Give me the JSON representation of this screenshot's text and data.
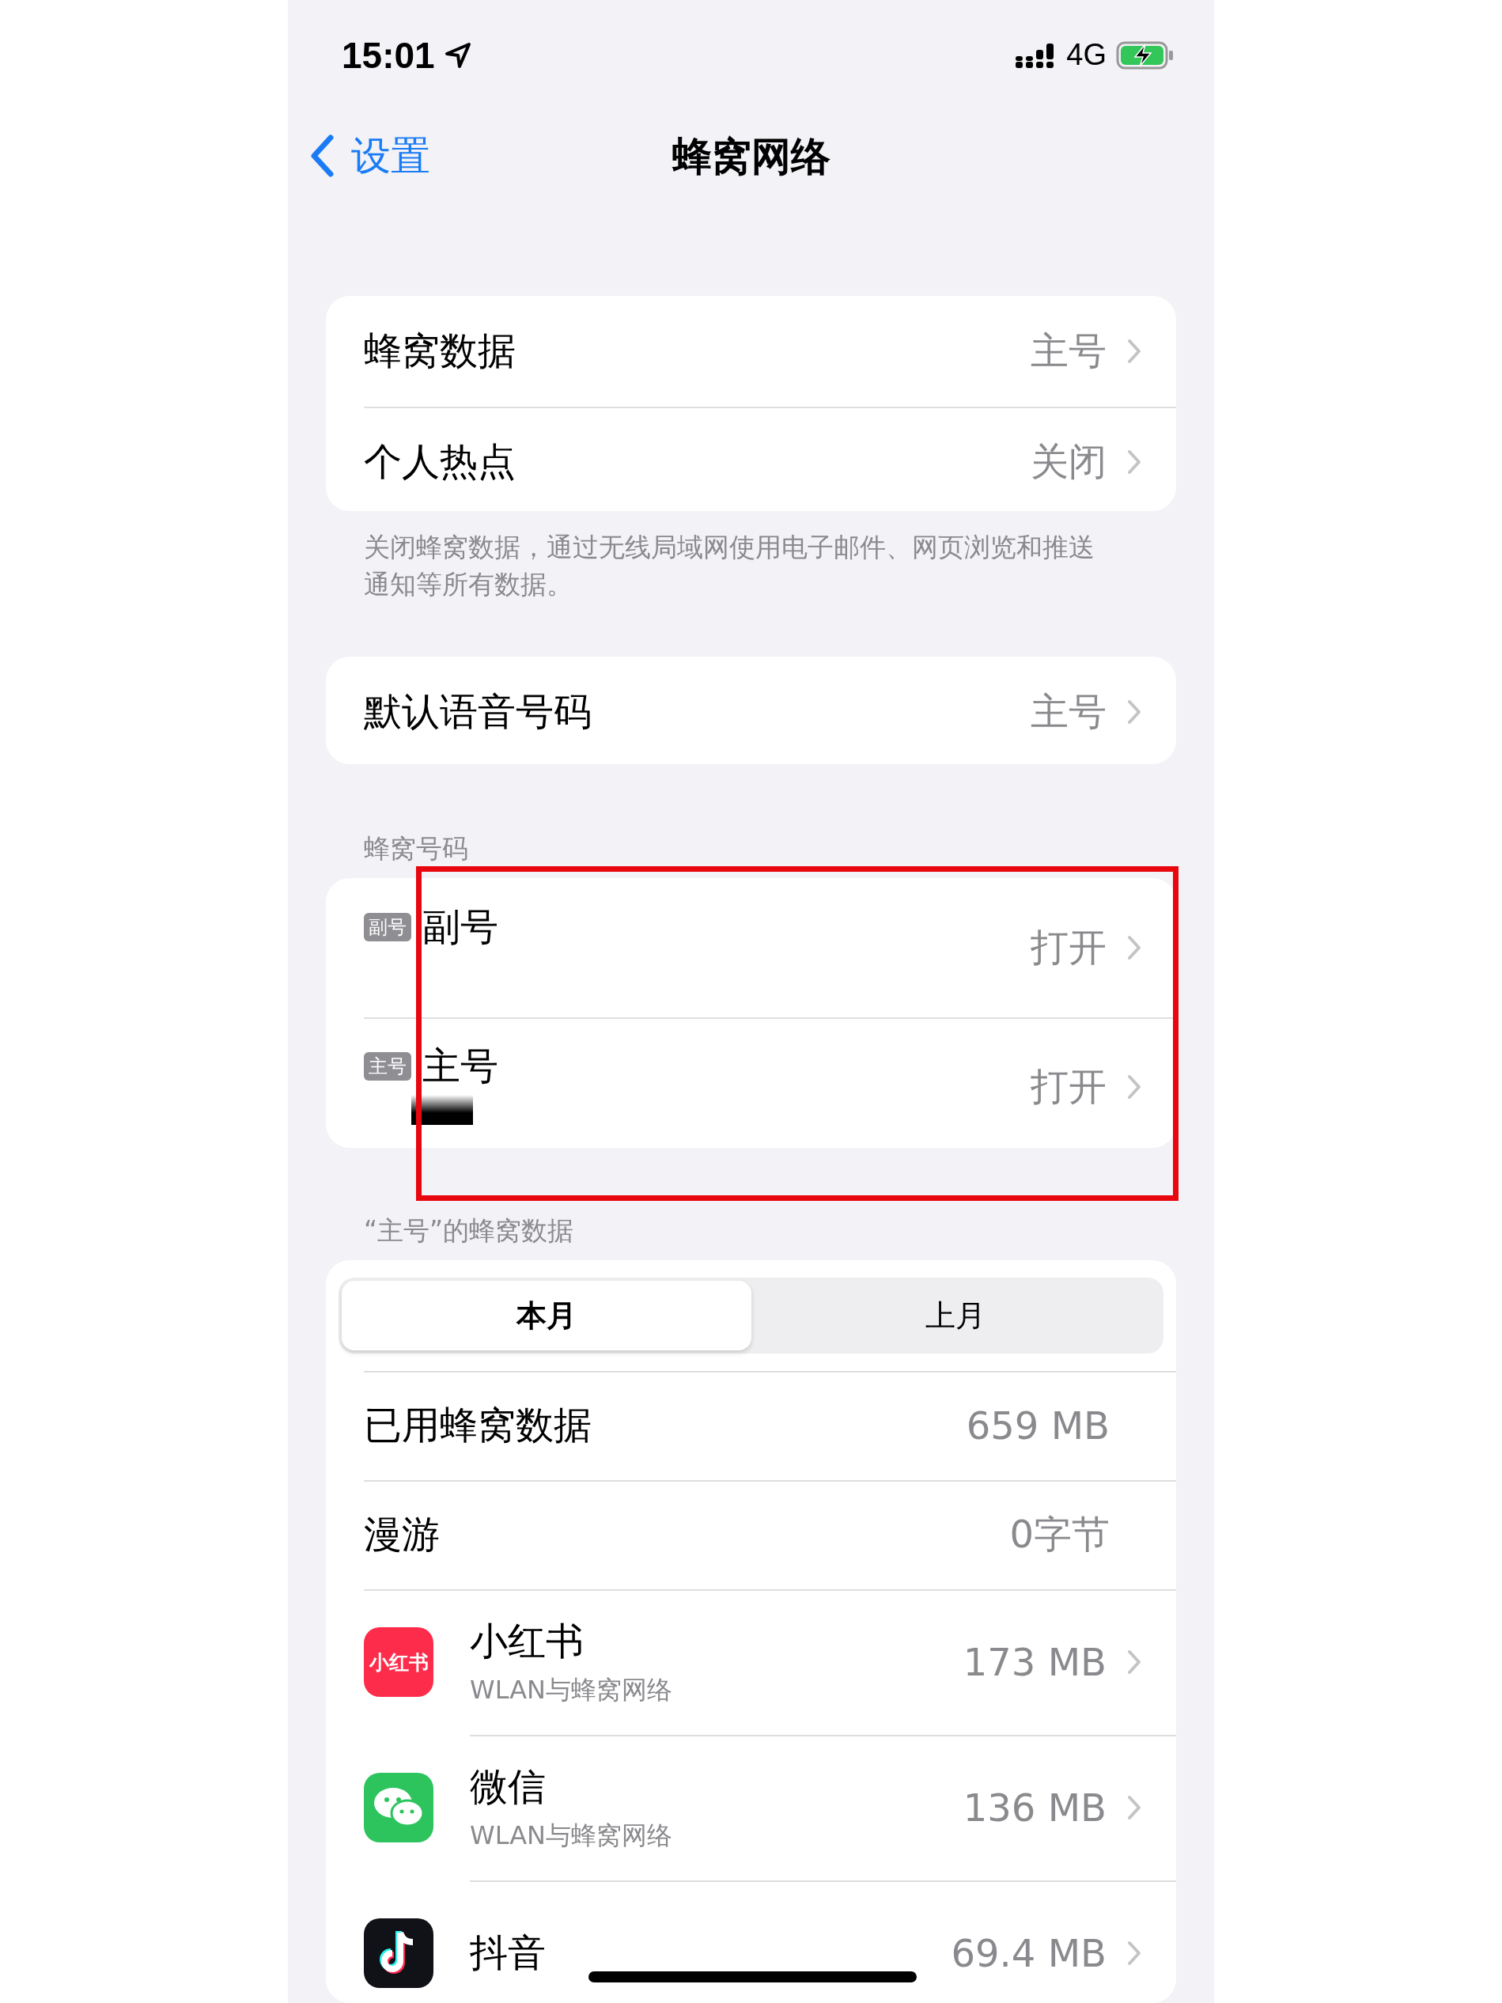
{
  "status_bar": {
    "time": "15:01",
    "network": "4G",
    "charging": true
  },
  "nav": {
    "back": "设置",
    "title": "蜂窝网络"
  },
  "group_1": {
    "rows": [
      {
        "label": "蜂窝数据",
        "value": "主号"
      },
      {
        "label": "个人热点",
        "value": "关闭"
      }
    ],
    "footer": "关闭蜂窝数据，通过无线局域网使用电子邮件、网页浏览和推送通知等所有数据。"
  },
  "group_2": {
    "rows": [
      {
        "label": "默认语音号码",
        "value": "主号"
      }
    ]
  },
  "numbers": {
    "header": "蜂窝号码",
    "rows": [
      {
        "badge": "副号",
        "label": "副号",
        "value": "打开",
        "redacted": false
      },
      {
        "badge": "主号",
        "label": "主号",
        "value": "打开",
        "redacted": true
      }
    ]
  },
  "annotation": {
    "kind": "highlight_frame"
  },
  "usage": {
    "header": "“主号”的蜂窝数据",
    "tabs": [
      {
        "label": "本月",
        "selected": true
      },
      {
        "label": "上月",
        "selected": false
      }
    ],
    "stats": [
      {
        "label": "已用蜂窝数据",
        "value": "659 MB"
      },
      {
        "label": "漫游",
        "value": "0字节"
      }
    ],
    "apps": [
      {
        "kind": "xiaohongshu",
        "logo_text": "小红书",
        "name": "小红书",
        "subtitle": "WLAN与蜂窝网络",
        "value": "173 MB"
      },
      {
        "kind": "wechat",
        "name": "微信",
        "subtitle": "WLAN与蜂窝网络",
        "value": "136 MB"
      },
      {
        "kind": "douyin",
        "name": "抖音",
        "value": "69.4 MB"
      }
    ]
  }
}
